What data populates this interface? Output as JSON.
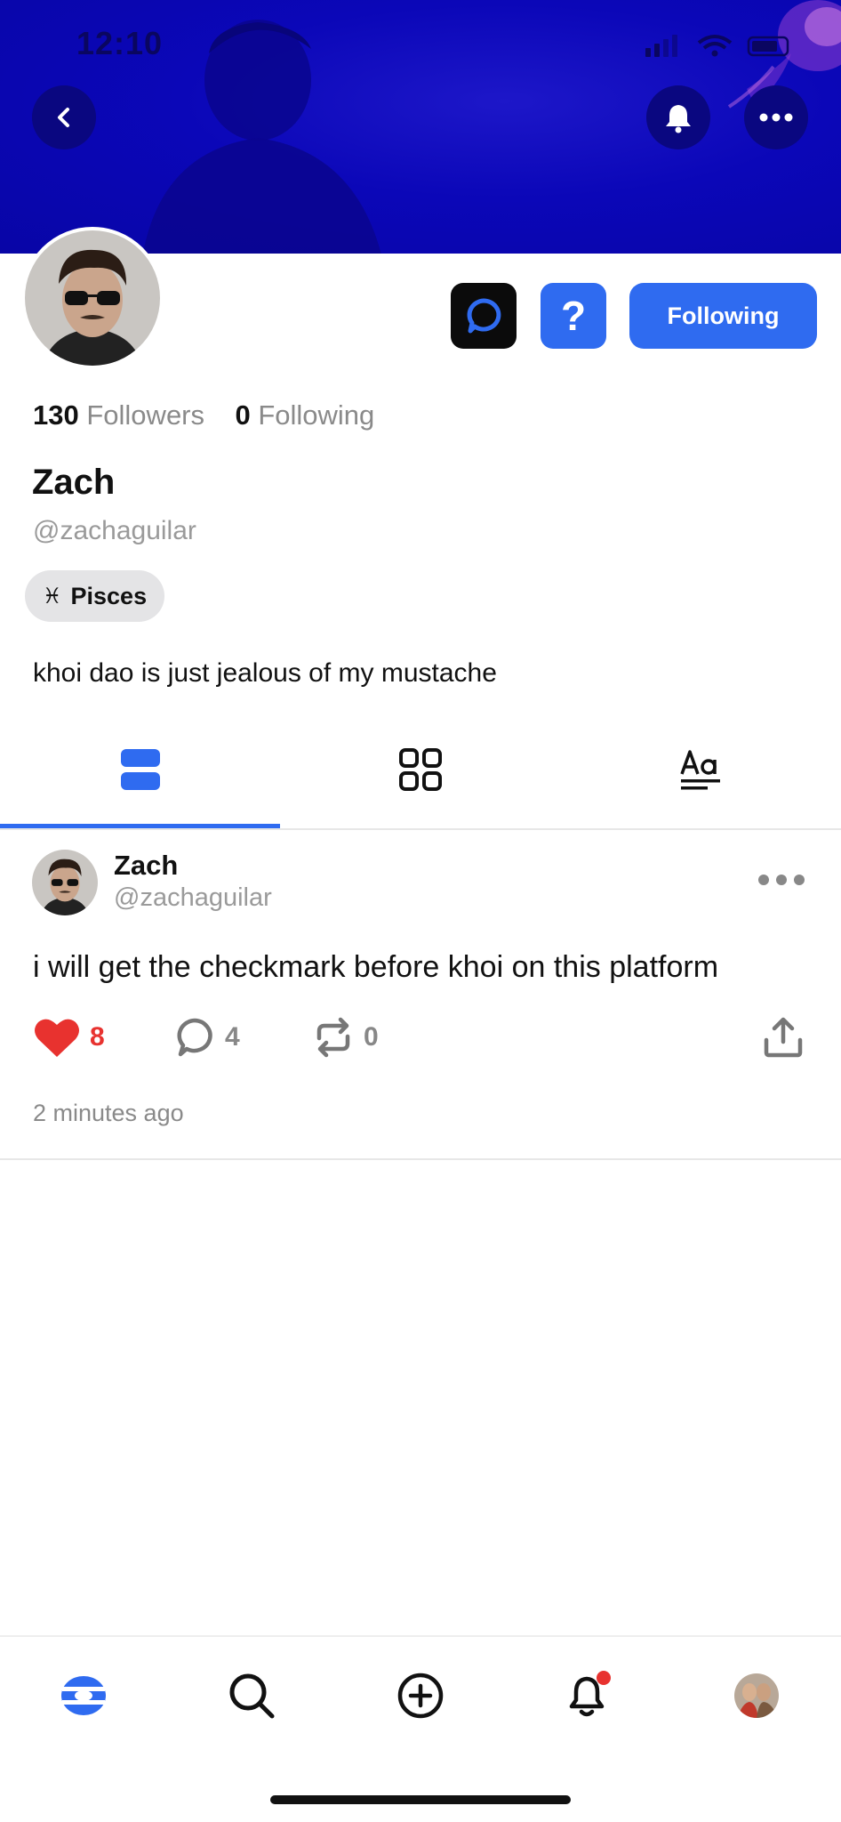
{
  "status_bar": {
    "time": "12:10"
  },
  "profile": {
    "followers_count": "130",
    "followers_label": "Followers",
    "following_count": "0",
    "following_label": "Following",
    "name": "Zach",
    "handle": "@zachaguilar",
    "zodiac_symbol": "♓",
    "zodiac": "Pisces",
    "bio": "khoi dao is just jealous of my mustache",
    "follow_button": "Following",
    "question_button": "?"
  },
  "tabs": [
    {
      "icon": "posts-list-icon",
      "active": true
    },
    {
      "icon": "grid-icon",
      "active": false
    },
    {
      "icon": "text-style-icon",
      "active": false
    }
  ],
  "post": {
    "author_name": "Zach",
    "author_handle": "@zachaguilar",
    "text": "i will get the checkmark before khoi on this platform",
    "likes": "8",
    "comments": "4",
    "reposts": "0",
    "time": "2 minutes ago"
  },
  "colors": {
    "accent": "#2f6bf0",
    "header_bg": "#0b07b8",
    "like": "#e8322f",
    "notification_dot": "#e8322f"
  },
  "nav": [
    {
      "icon": "home-icon"
    },
    {
      "icon": "search-icon"
    },
    {
      "icon": "compose-icon"
    },
    {
      "icon": "notifications-icon",
      "badge": true
    },
    {
      "icon": "profile-avatar-icon"
    }
  ]
}
